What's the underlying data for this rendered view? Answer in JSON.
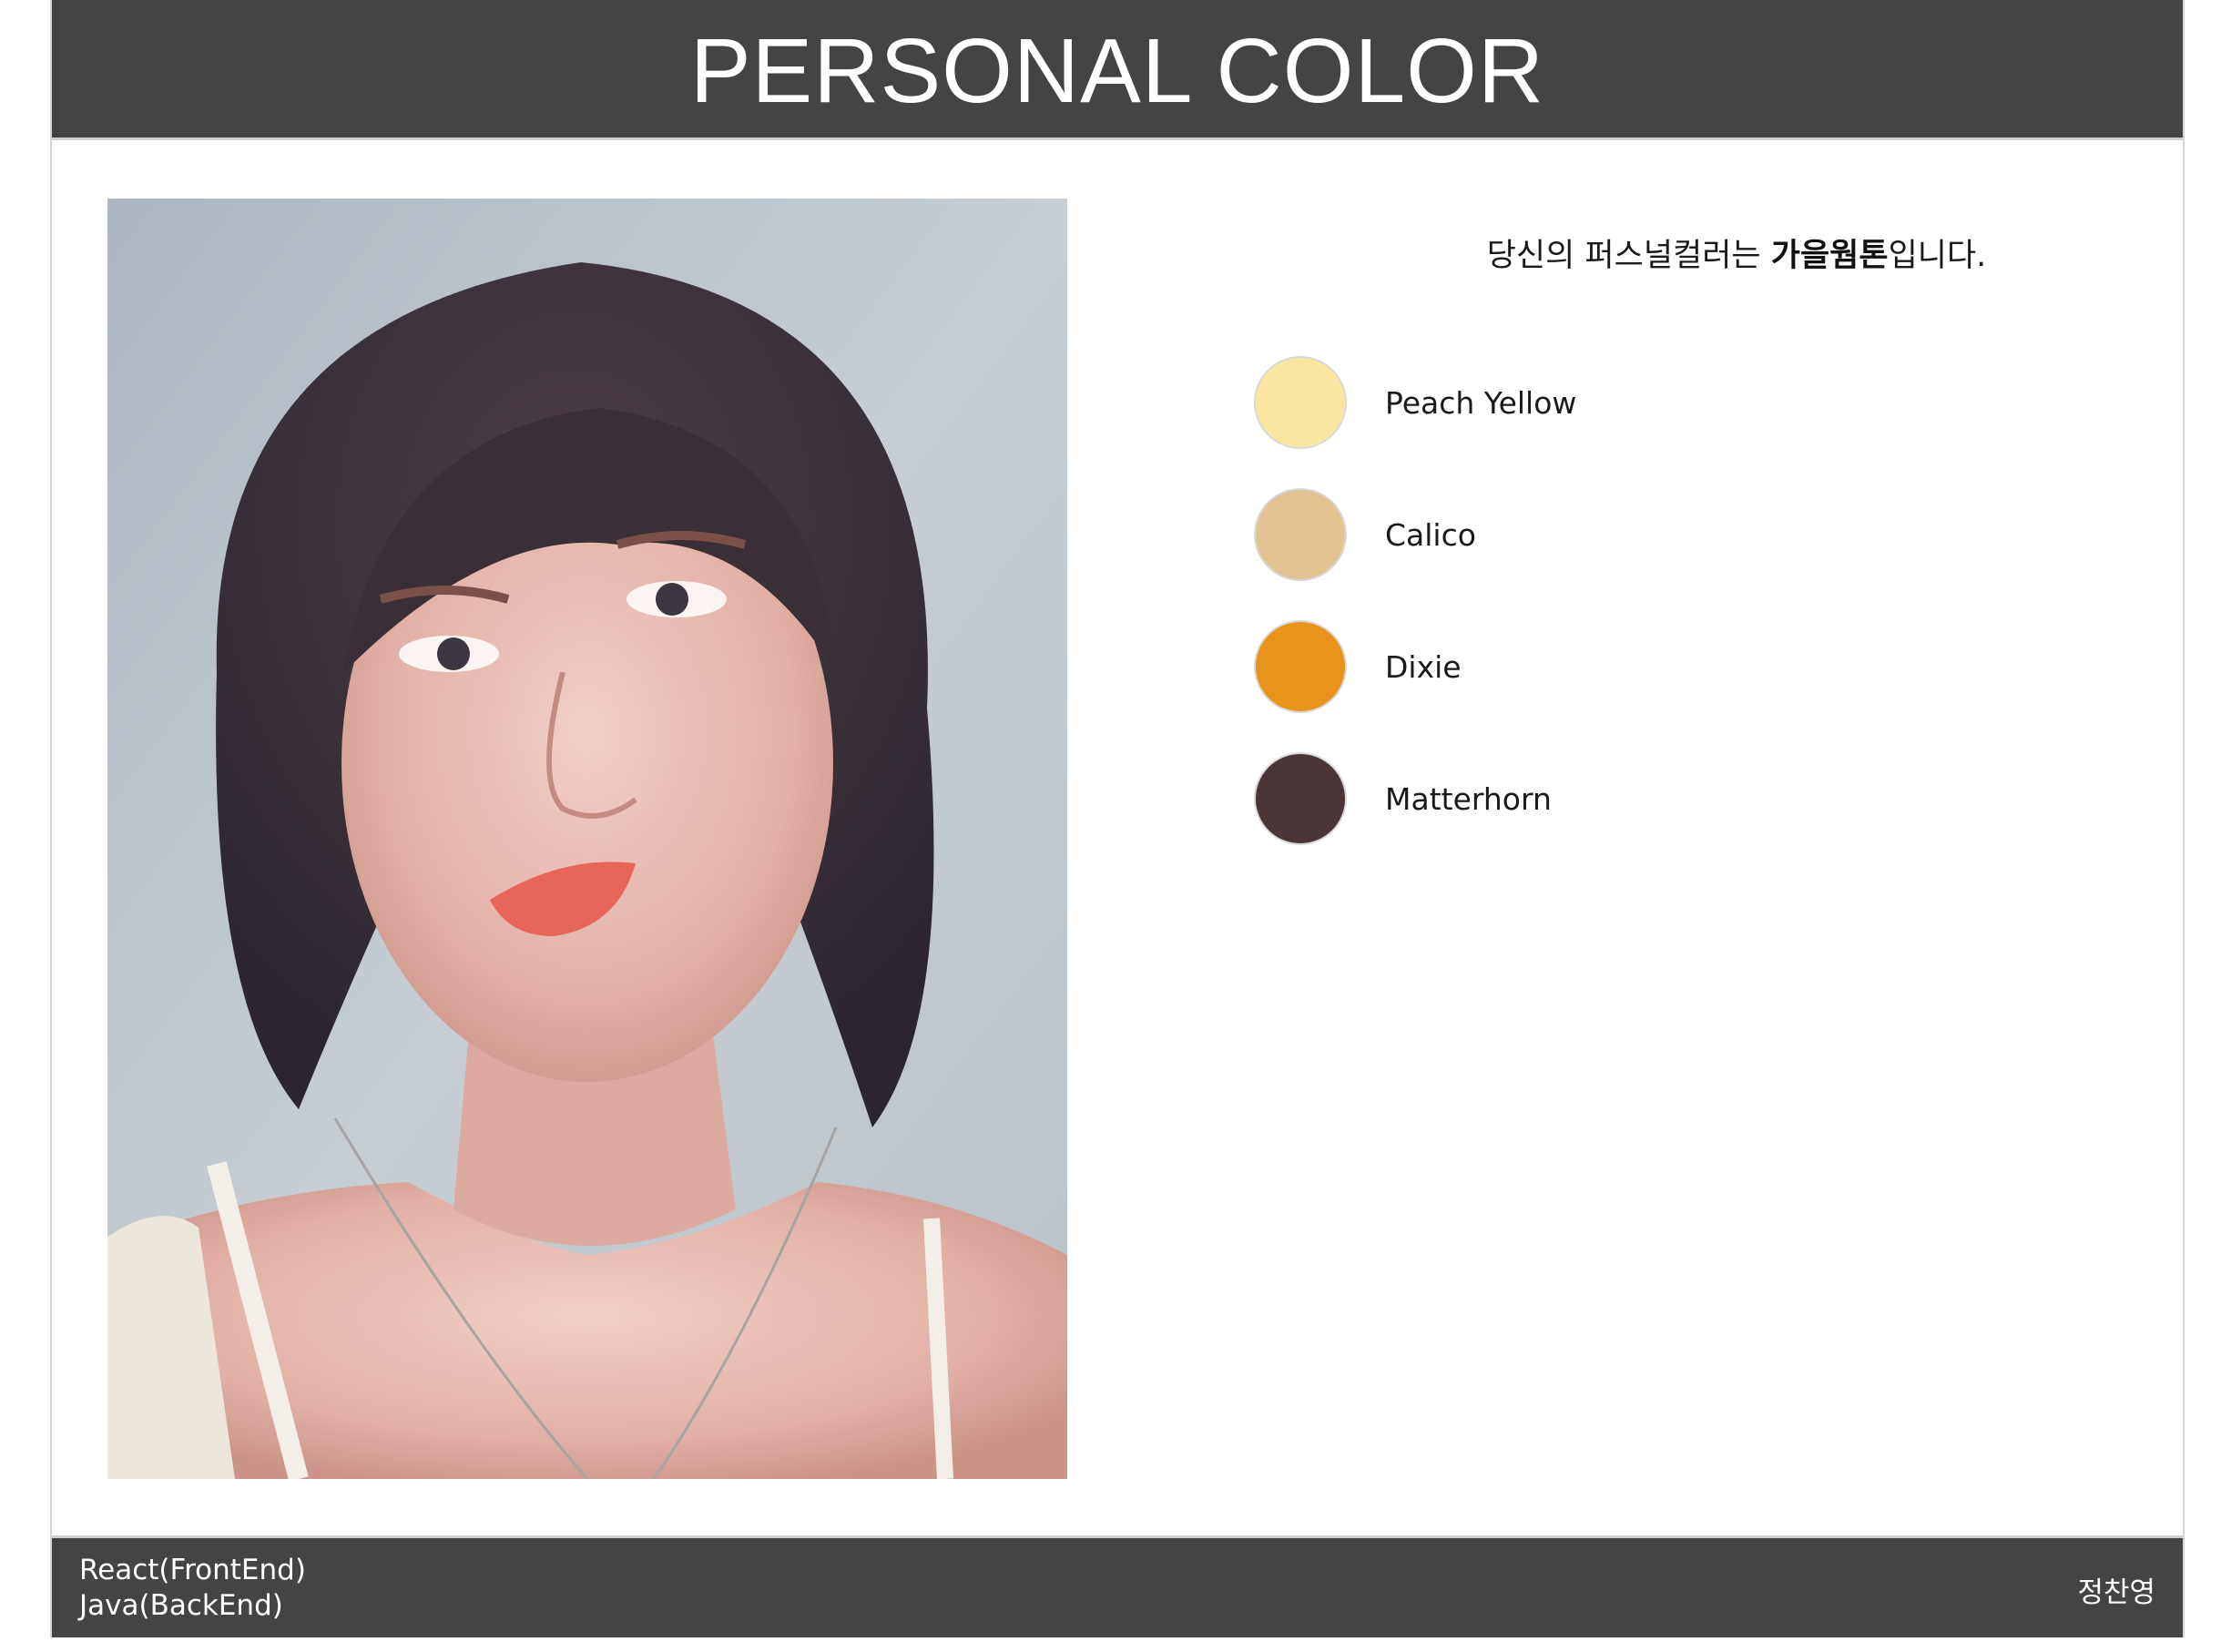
{
  "header": {
    "title": "PERSONAL COLOR"
  },
  "result": {
    "prefix": "당신의 퍼스널컬러는 ",
    "tone": "가을웜톤",
    "suffix": "입니다."
  },
  "palette": [
    {
      "name": "Peach Yellow",
      "color": "#FAE6A0"
    },
    {
      "name": "Calico",
      "color": "#E3C391"
    },
    {
      "name": "Dixie",
      "color": "#E8941C"
    },
    {
      "name": "Matterhorn",
      "color": "#4A3636"
    }
  ],
  "footer": {
    "stack_front": "React(FrontEnd)",
    "stack_back": "Java(BackEnd)",
    "author": "정찬영"
  },
  "colors": {
    "bar_background": "#444444",
    "page_background": "#FFFFFF"
  },
  "photo": {
    "subject": "portrait-photo"
  }
}
